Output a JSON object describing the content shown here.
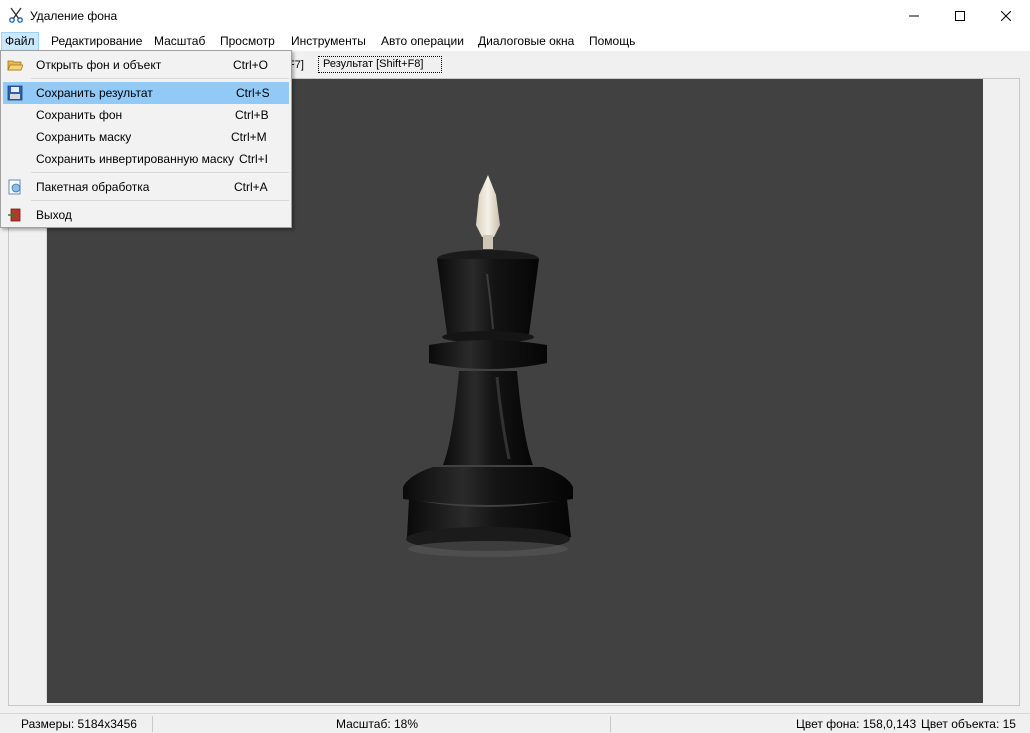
{
  "window": {
    "title": "Удаление фона",
    "app_icon": "scissors-icon",
    "minimize_icon": "minimize-icon",
    "maximize_icon": "maximize-icon",
    "close_icon": "close-icon"
  },
  "menubar": {
    "items": [
      "Файл",
      "Редактирование",
      "Масштаб",
      "Просмотр",
      "Инструменты",
      "Авто операции",
      "Диалоговые окна",
      "Помощь"
    ],
    "active": "Файл"
  },
  "toolbar": {
    "partial_tab_text": "F7]",
    "result_tab": "Результат    [Shift+F8]"
  },
  "file_menu": {
    "items": [
      {
        "label": "Открыть фон и объект",
        "shortcut": "Ctrl+O",
        "icon": "open-folder-icon"
      },
      {
        "label": "Сохранить результат",
        "shortcut": "Ctrl+S",
        "icon": "floppy-disk-icon",
        "highlighted": true
      },
      {
        "label": "Сохранить фон",
        "shortcut": "Ctrl+B"
      },
      {
        "label": "Сохранить маску",
        "shortcut": "Ctrl+M"
      },
      {
        "label": "Сохранить инвертированную маску",
        "shortcut": "Ctrl+I"
      },
      {
        "label": "Пакетная обработка",
        "shortcut": "Ctrl+A",
        "icon": "batch-process-icon"
      },
      {
        "label": "Выход",
        "icon": "exit-door-icon"
      }
    ]
  },
  "canvas": {
    "background_color": "#414141",
    "subject": "chess-pawn-image"
  },
  "statusbar": {
    "size": "Размеры: 5184x3456",
    "zoom": "Масштаб: 18%",
    "bg_color": "Цвет фона: 158,0,143",
    "obj_color": "Цвет объекта: 15"
  },
  "colors": {
    "menu_highlight": "#91c9f7",
    "menu_active": "#cce8ff"
  }
}
